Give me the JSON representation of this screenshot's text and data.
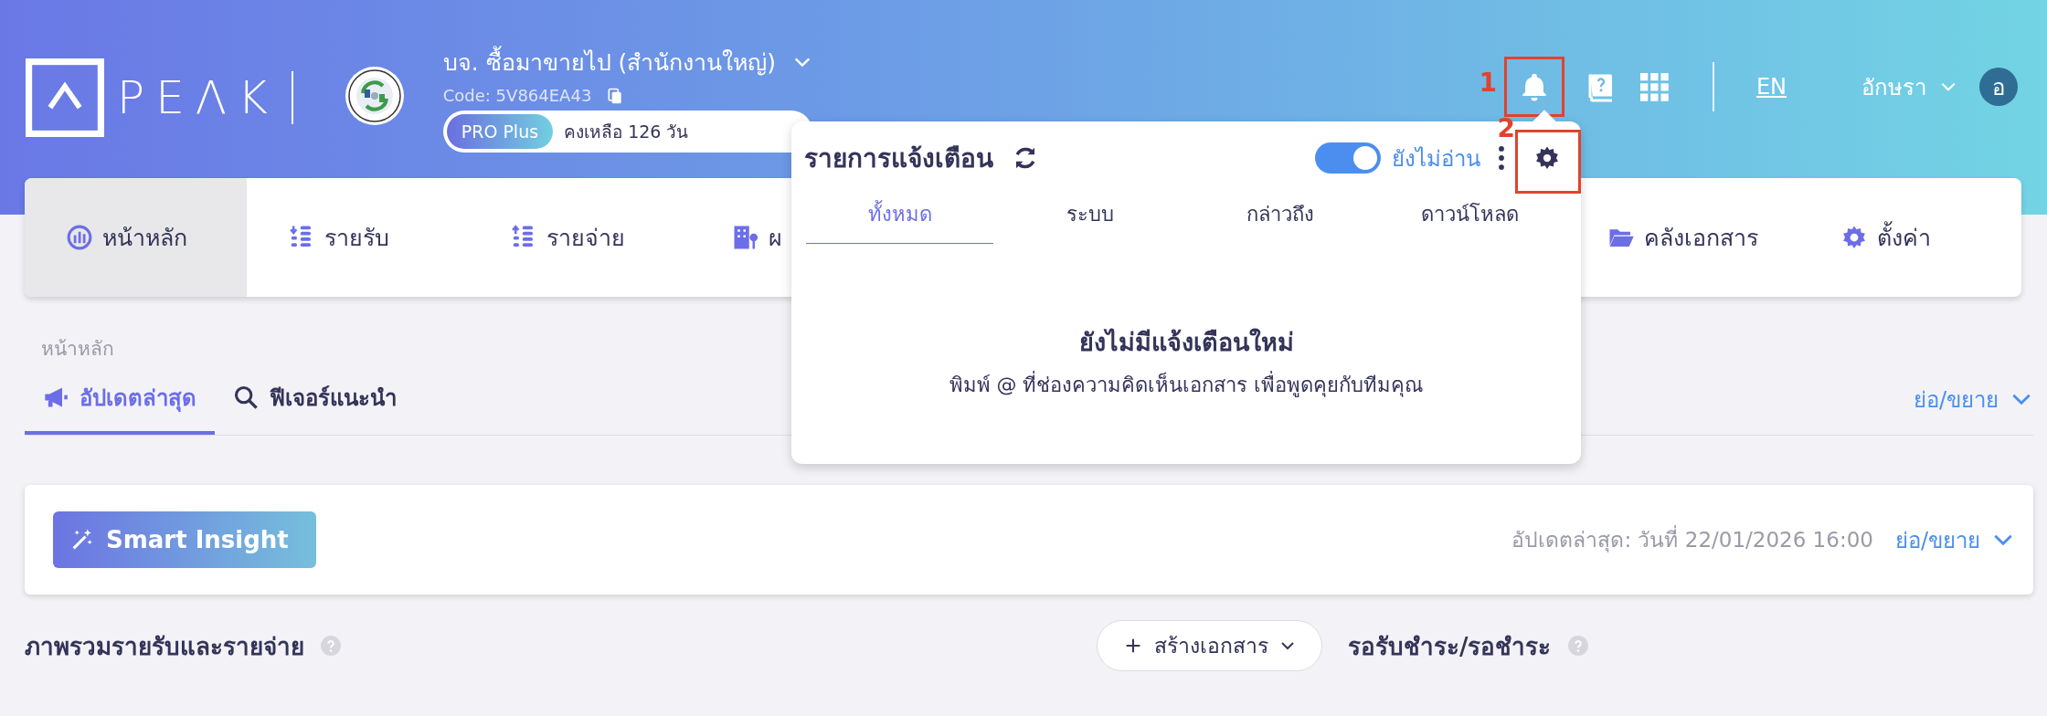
{
  "header": {
    "logo": "PEΛK",
    "company": {
      "name": "บจ. ซื้อมาขายไป (สำนักงานใหญ่)",
      "code": "Code: 5V864EA43",
      "plan": "PRO Plus",
      "remaining": "คงเหลือ 126 วัน"
    },
    "language": "EN",
    "user": {
      "name": "อักษรา",
      "initial": "อ"
    }
  },
  "nav": [
    {
      "label": "หน้าหลัก",
      "kind": "dashboard",
      "selected": true
    },
    {
      "label": "รายรับ",
      "kind": "income",
      "selected": false
    },
    {
      "label": "รายจ่าย",
      "kind": "expense",
      "selected": false
    },
    {
      "label": "ผ",
      "kind": "building",
      "selected": false
    },
    {
      "label": "คลังเอกสาร",
      "kind": "folder",
      "selected": false
    },
    {
      "label": "ตั้งค่า",
      "kind": "gear",
      "selected": false
    }
  ],
  "breadcrumb": "หน้าหลัก",
  "tabs": [
    {
      "label": "อัปเดตล่าสุด",
      "kind": "megaphone",
      "selected": true
    },
    {
      "label": "ฟีเจอร์แนะนำ",
      "kind": "search",
      "selected": false
    }
  ],
  "collapse_label": "ย่อ/ขยาย",
  "insight": {
    "button": "Smart Insight",
    "updated": "อัปเดตล่าสุด: วันที่ 22/01/2026 16:00",
    "collapse": "ย่อ/ขยาย"
  },
  "overview": {
    "title": "ภาพรวมรายรับและรายจ่าย",
    "create_button": "สร้างเอกสาร",
    "receivables_title": "รอรับชำระ/รอชำระ"
  },
  "notifications": {
    "title": "รายการแจ้งเตือน",
    "unread_only": {
      "label": "ยังไม่อ่าน",
      "on": true
    },
    "tabs": [
      {
        "label": "ทั้งหมด",
        "selected": true
      },
      {
        "label": "ระบบ",
        "selected": false
      },
      {
        "label": "กล่าวถึง",
        "selected": false
      },
      {
        "label": "ดาวน์โหลด",
        "selected": false
      }
    ],
    "empty_title": "ยังไม่มีแจ้งเตือนใหม่",
    "empty_hint": "พิมพ์ @ ที่ช่องความคิดเห็นเอกสาร เพื่อพูดคุยกับทีมคุณ"
  },
  "annotations": [
    {
      "label": "1"
    },
    {
      "label": "2"
    }
  ]
}
